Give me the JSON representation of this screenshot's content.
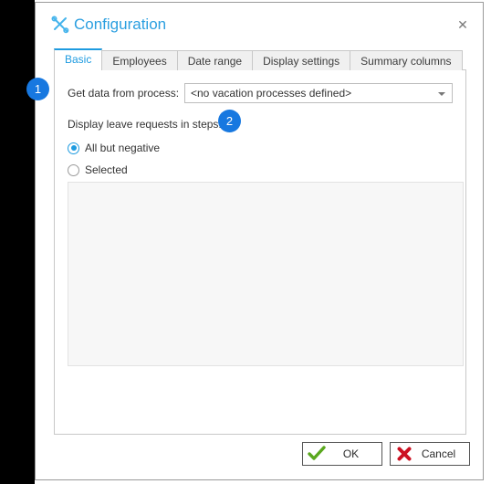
{
  "window": {
    "title": "Configuration",
    "title_icon": "tools-wrench-screwdriver-icon",
    "close_label": "✕",
    "accent_color": "#2b9fe0",
    "badge_color": "#1778e0"
  },
  "tabs": [
    {
      "label": "Basic",
      "active": true
    },
    {
      "label": "Employees",
      "active": false
    },
    {
      "label": "Date range",
      "active": false
    },
    {
      "label": "Display settings",
      "active": false
    },
    {
      "label": "Summary columns",
      "active": false
    }
  ],
  "basic_tab": {
    "process": {
      "label": "Get data from process:",
      "selected_value": "<no vacation processes defined>",
      "options": [
        "<no vacation processes defined>"
      ]
    },
    "steps": {
      "label": "Display leave requests in steps:",
      "options": [
        {
          "label": "All but negative",
          "selected": true
        },
        {
          "label": "Selected",
          "selected": false
        }
      ],
      "list_items": []
    }
  },
  "footer": {
    "ok_label": "OK",
    "ok_icon": "green-check-icon",
    "cancel_label": "Cancel",
    "cancel_icon": "red-cross-icon"
  },
  "annotations": [
    {
      "number": "1"
    },
    {
      "number": "2"
    }
  ]
}
